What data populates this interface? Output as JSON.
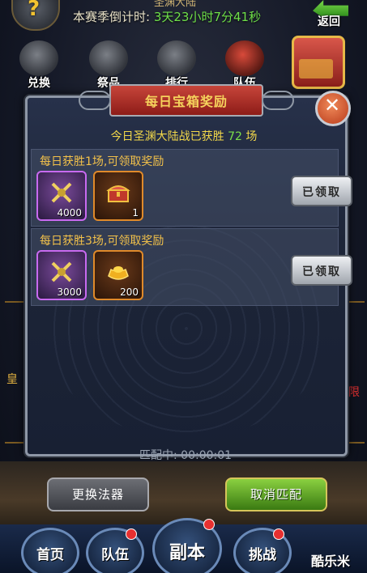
{
  "header": {
    "title": "圣渊大陆",
    "countdown_label": "本赛季倒计时:",
    "countdown_value": "3天23小时7分41秒",
    "help_glyph": "?",
    "back_label": "返回"
  },
  "top_menu": [
    {
      "label": "兑换",
      "icon": "bag-icon"
    },
    {
      "label": "祭品",
      "icon": "offering-icon"
    },
    {
      "label": "排行",
      "icon": "ranking-scroll-icon"
    },
    {
      "label": "队伍",
      "icon": "flag-icon"
    }
  ],
  "side": {
    "left_char": "皇",
    "right_char": "限"
  },
  "dialog": {
    "title": "每日宝箱奖励",
    "close_glyph": "✕",
    "wins_prefix": "今日圣渊大陆战已获胜",
    "wins_count": "72",
    "wins_suffix": "场",
    "rows": [
      {
        "label": "每日获胜1场,可领取奖励",
        "items": [
          {
            "icon": "crossed-swords-icon",
            "quantity": "4000",
            "frame": "purple"
          },
          {
            "icon": "treasure-chest-icon",
            "quantity": "1",
            "frame": "orange"
          }
        ],
        "button_label": "已领取"
      },
      {
        "label": "每日获胜3场,可领取奖励",
        "items": [
          {
            "icon": "crossed-swords-icon",
            "quantity": "3000",
            "frame": "purple"
          },
          {
            "icon": "gold-ingot-icon",
            "quantity": "200",
            "frame": "orange"
          }
        ],
        "button_label": "已领取"
      }
    ]
  },
  "match_time": "匹配中: 00:00:01",
  "actions": {
    "swap_label": "更换法器",
    "cancel_label": "取消匹配"
  },
  "nav": [
    {
      "label": "首页",
      "badge": false
    },
    {
      "label": "队伍",
      "badge": true
    },
    {
      "label": "副本",
      "badge": true
    },
    {
      "label": "挑战",
      "badge": true
    }
  ],
  "watermark": "酷乐米",
  "colors": {
    "accent_gold": "#f2c14a",
    "accent_green": "#7be04a",
    "banner_red": "#c7453a"
  }
}
